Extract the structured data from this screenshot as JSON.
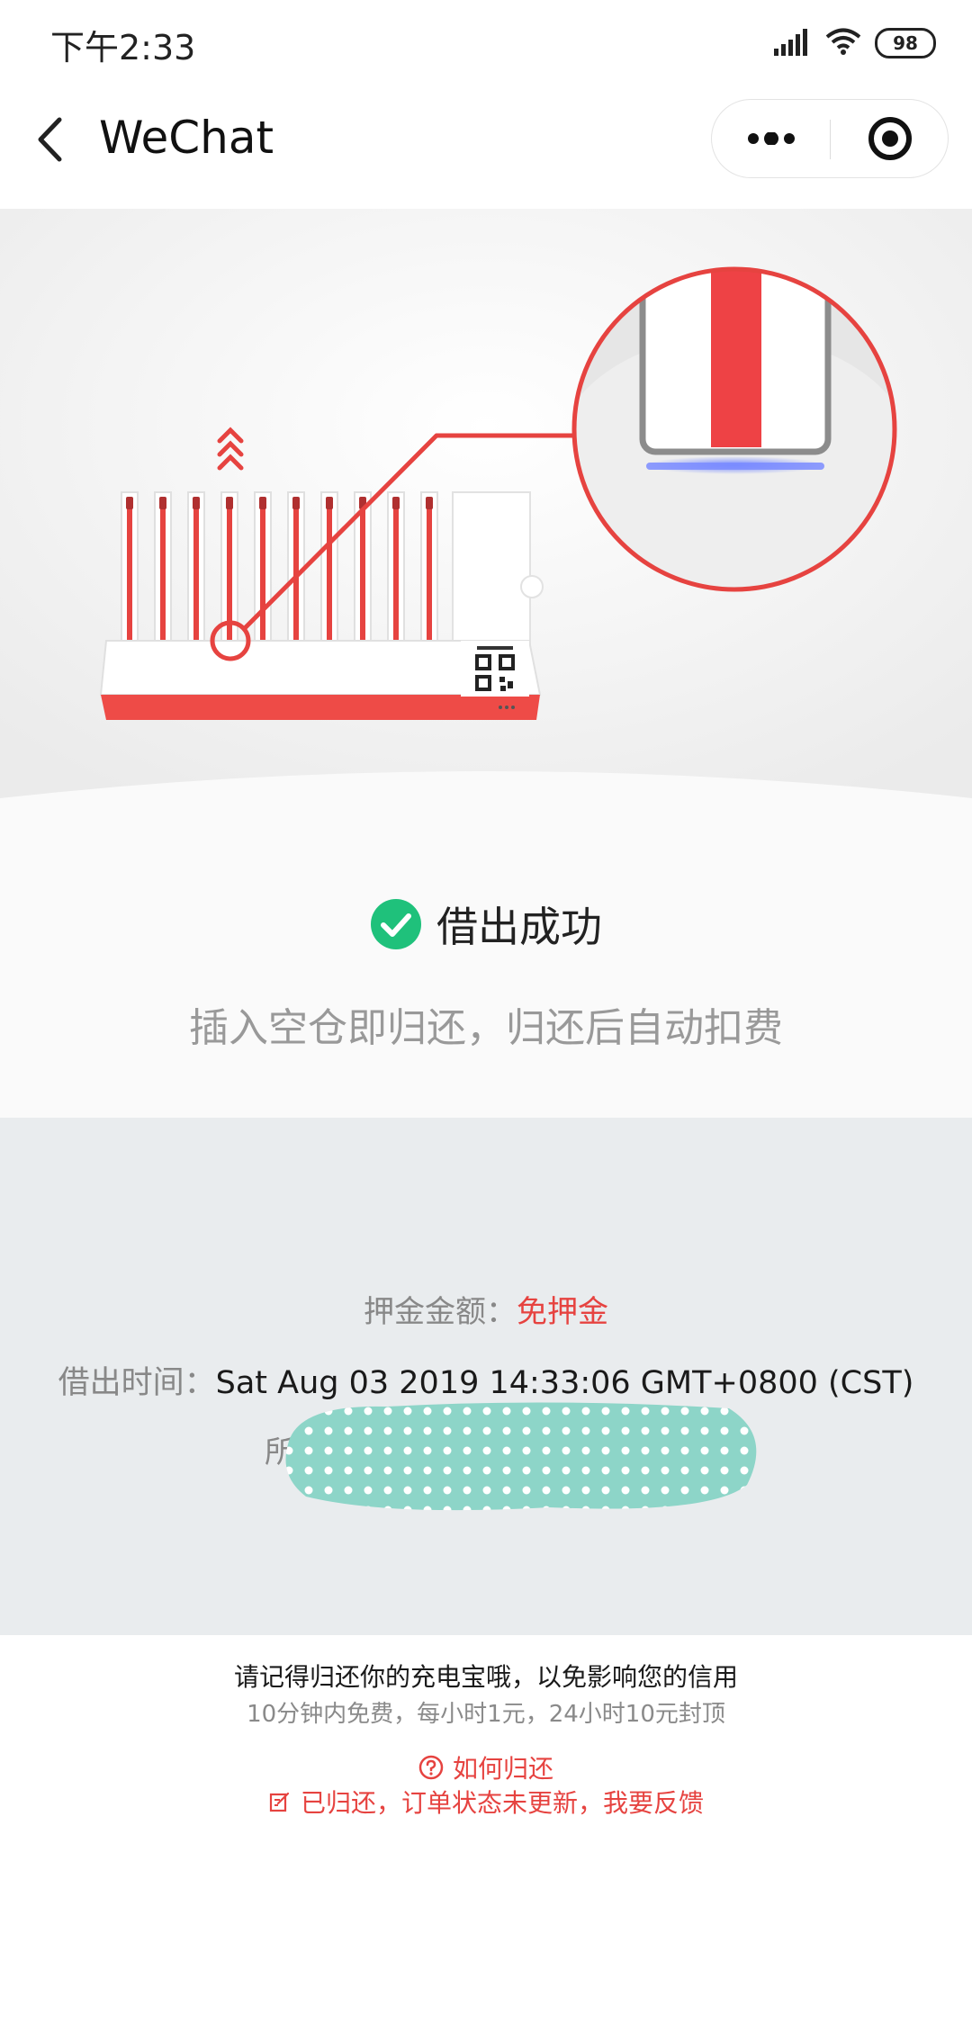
{
  "status_bar": {
    "time": "下午2:33",
    "battery": "98"
  },
  "nav": {
    "title": "WeChat"
  },
  "success": {
    "title": "借出成功",
    "description": "插入空仓即归还，归还后自动扣费"
  },
  "details": {
    "deposit_label": "押金金额：",
    "deposit_value": "免押金",
    "borrow_time_label": "借出时间：",
    "borrow_time_value": "Sat Aug 03 2019 14:33:06 GMT+0800 (CST)",
    "location_label_partial": "所"
  },
  "footer": {
    "reminder": "请记得归还你的充电宝哦，以免影响您的信用",
    "pricing": "10分钟内免费，每小时1元，24小时10元封顶",
    "how_to_return": "如何归还",
    "feedback": "已归还，订单状态未更新，我要反馈"
  },
  "colors": {
    "accent_red": "#e64340",
    "success_green": "#1fc17b",
    "panel_gray": "#e9ecee"
  }
}
